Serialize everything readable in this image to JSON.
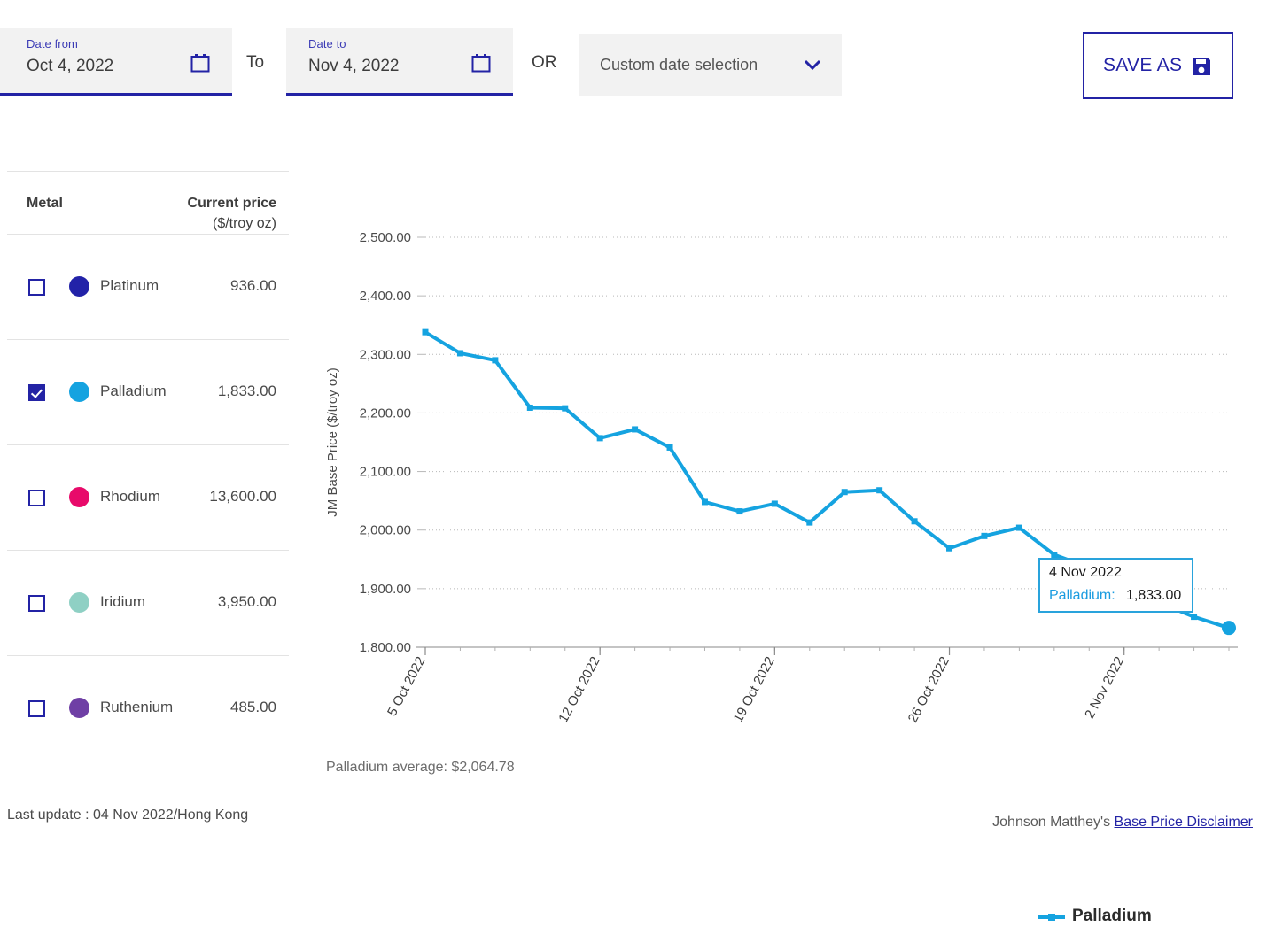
{
  "header": {
    "date_from": {
      "label": "Date from",
      "value": "Oct 4, 2022",
      "icon": "calendar-icon"
    },
    "separator_to": "To",
    "date_to": {
      "label": "Date to",
      "value": "Nov 4, 2022",
      "icon": "calendar-icon"
    },
    "separator_or": "OR",
    "custom_select": {
      "value": "Custom date selection",
      "icon": "chevron-down-icon"
    },
    "save_as": {
      "label": "SAVE AS",
      "icon": "save-floppy-icon"
    }
  },
  "sidebar": {
    "columns": {
      "metal": "Metal",
      "current_price": "Current price",
      "unit": "($/troy oz)"
    },
    "rows": [
      {
        "name": "Platinum",
        "price": "936.00",
        "color": "#2222a8",
        "checked": false
      },
      {
        "name": "Palladium",
        "price": "1,833.00",
        "color": "#15a3e0",
        "checked": true
      },
      {
        "name": "Rhodium",
        "price": "13,600.00",
        "color": "#e80a6a",
        "checked": false
      },
      {
        "name": "Iridium",
        "price": "3,950.00",
        "color": "#8fd0c4",
        "checked": false
      },
      {
        "name": "Ruthenium",
        "price": "485.00",
        "color": "#6f3fa5",
        "checked": false
      }
    ],
    "last_update": "Last update : 04 Nov 2022/Hong Kong"
  },
  "chart_extras": {
    "average_text": "Palladium average: $2,064.78",
    "tooltip": {
      "date": "4 Nov 2022",
      "series": "Palladium:",
      "value": "1,833.00"
    },
    "disclaimer_prefix": "Johnson Matthey's ",
    "disclaimer_link": "Base Price Disclaimer"
  },
  "chart_data": {
    "type": "line",
    "title": "",
    "xlabel": "",
    "ylabel": "JM Base Price ($/troy oz)",
    "ylim": [
      1800,
      2500
    ],
    "yticks": [
      2500,
      2400,
      2300,
      2200,
      2100,
      2000,
      1900,
      1800
    ],
    "ytick_labels": [
      "2,500.00",
      "2,400.00",
      "2,300.00",
      "2,200.00",
      "2,100.00",
      "2,000.00",
      "1,900.00",
      "1,800.00"
    ],
    "xticks": [
      "5 Oct 2022",
      "12 Oct 2022",
      "19 Oct 2022",
      "26 Oct 2022",
      "2 Nov 2022"
    ],
    "xtick_indices": [
      0,
      5,
      10,
      15,
      20
    ],
    "grid": true,
    "legend_position": "bottom",
    "legend": [
      "Palladium"
    ],
    "color": "#15a3e0",
    "series": [
      {
        "name": "Palladium",
        "x": [
          "4 Oct 2022",
          "5 Oct 2022",
          "6 Oct 2022",
          "7 Oct 2022",
          "10 Oct 2022",
          "11 Oct 2022",
          "12 Oct 2022",
          "13 Oct 2022",
          "14 Oct 2022",
          "17 Oct 2022",
          "18 Oct 2022",
          "19 Oct 2022",
          "20 Oct 2022",
          "21 Oct 2022",
          "24 Oct 2022",
          "25 Oct 2022",
          "26 Oct 2022",
          "27 Oct 2022",
          "28 Oct 2022",
          "31 Oct 2022",
          "1 Nov 2022",
          "2 Nov 2022",
          "3 Nov 2022",
          "4 Nov 2022"
        ],
        "values": [
          2338,
          2302,
          2290,
          2209,
          2208,
          2157,
          2172,
          2141,
          2048,
          2032,
          2045,
          2013,
          2065,
          2068,
          2015,
          1969,
          1990,
          2004,
          1958,
          1936,
          1900,
          1876,
          1852,
          1833
        ]
      }
    ]
  }
}
